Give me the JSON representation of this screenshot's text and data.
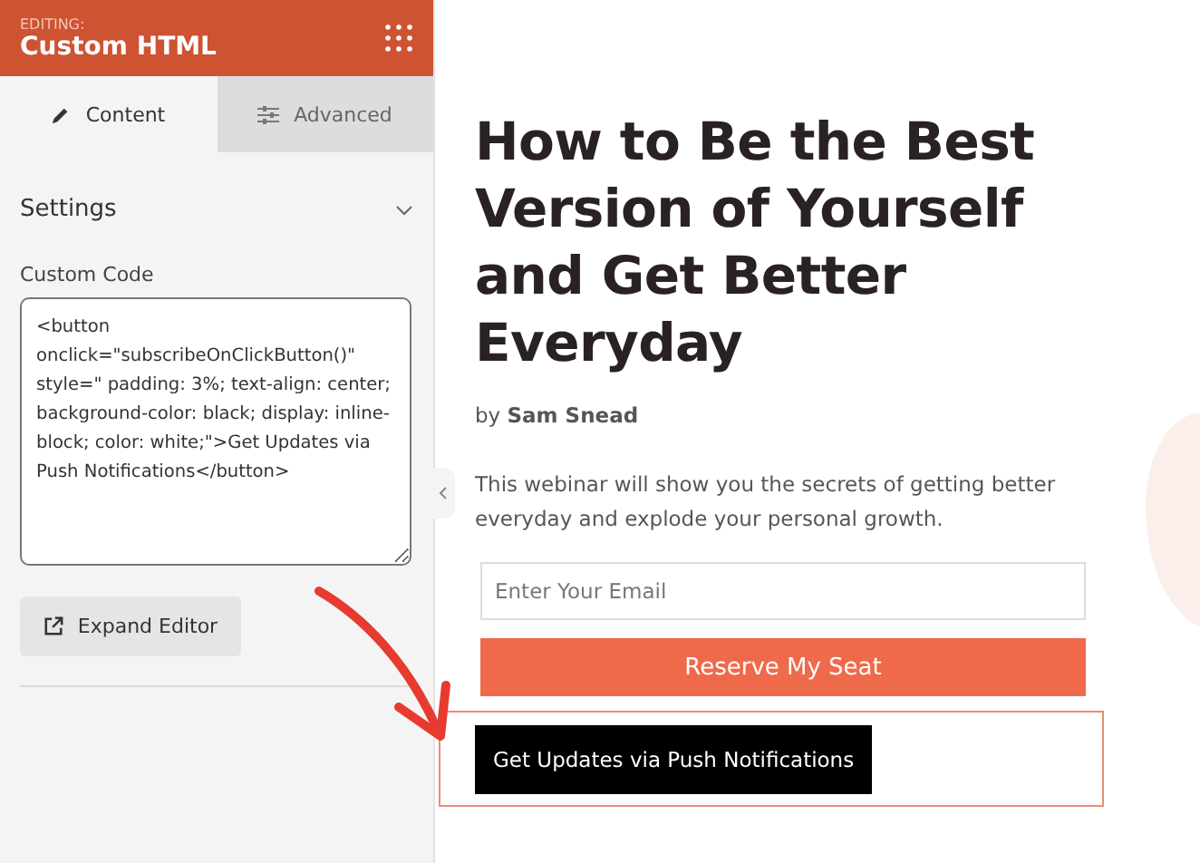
{
  "header": {
    "eyebrow": "EDITING:",
    "title": "Custom HTML"
  },
  "tabs": [
    {
      "label": "Content",
      "selected": true
    },
    {
      "label": "Advanced",
      "selected": false
    }
  ],
  "settings": {
    "title": "Settings",
    "expanded": true,
    "field_label": "Custom Code",
    "code": "<button onclick=\"subscribeOnClickButton()\" style=\" padding: 3%; text-align: center; background-color: black; display: inline-block; color: white;\">Get Updates via Push Notifications</button>",
    "expand_button": "Expand Editor"
  },
  "page": {
    "heading": "How to Be the Best Version of Yourself and Get Better Everyday",
    "byline": "by **Sam Snead**",
    "description": "This webinar will show you the secrets of getting better everyday and explode your personal growth.",
    "email_placeholder": "Enter Your Email",
    "reserve_button": "Reserve My Seat",
    "custom_button": "Get Updates via Push Notifications",
    "custom_selected": true
  }
}
